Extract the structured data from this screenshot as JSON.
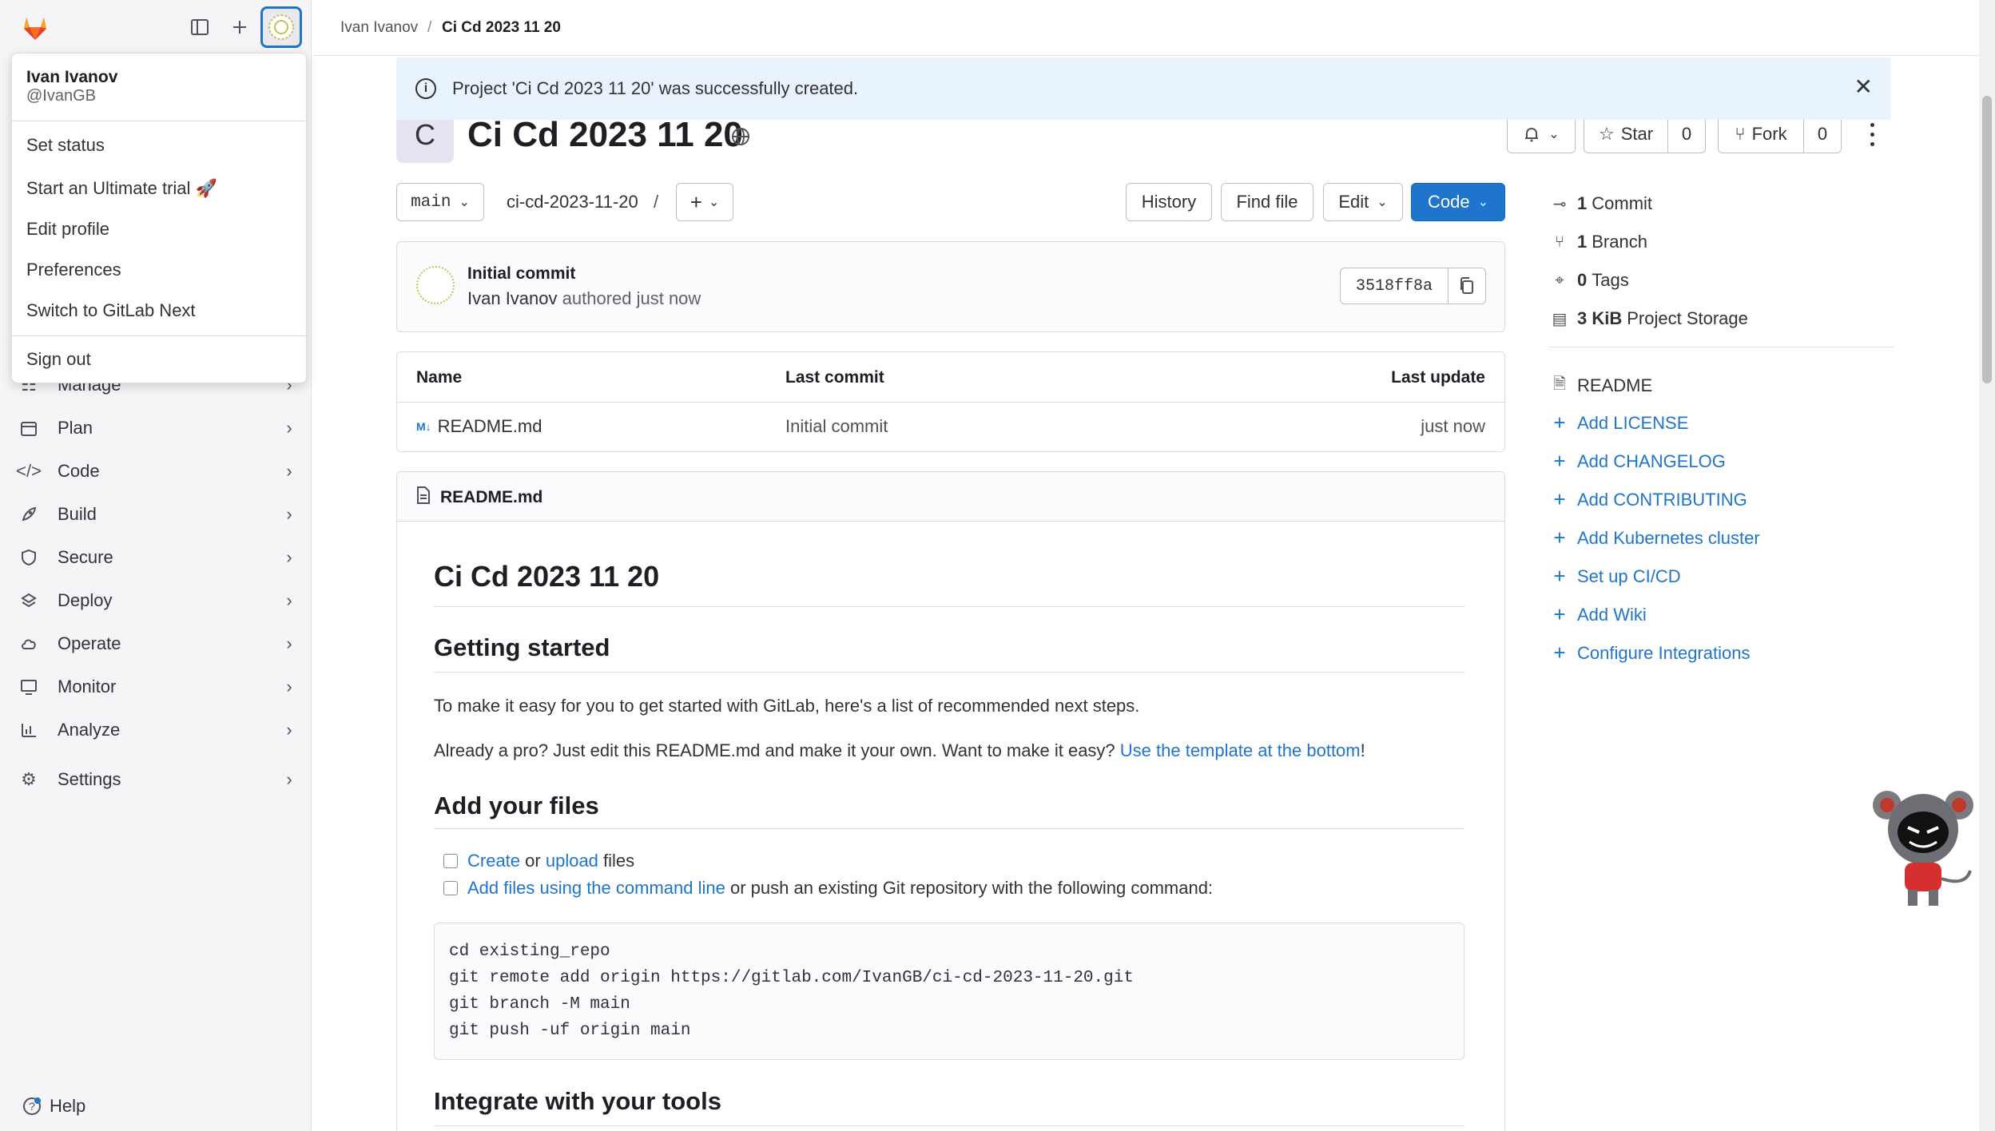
{
  "breadcrumb": {
    "user": "Ivan Ivanov",
    "separator": "/",
    "project": "Ci Cd 2023 11 20"
  },
  "user_menu": {
    "name": "Ivan Ivanov",
    "handle": "@IvanGB",
    "items": [
      "Set status",
      "Start an Ultimate trial 🚀",
      "Edit profile",
      "Preferences",
      "Switch to GitLab Next"
    ],
    "sign_out": "Sign out"
  },
  "sidebar": {
    "items": [
      {
        "label": "Manage",
        "icon": "users-icon"
      },
      {
        "label": "Plan",
        "icon": "calendar-icon"
      },
      {
        "label": "Code",
        "icon": "code-icon"
      },
      {
        "label": "Build",
        "icon": "rocket-icon"
      },
      {
        "label": "Secure",
        "icon": "shield-icon"
      },
      {
        "label": "Deploy",
        "icon": "deploy-icon"
      },
      {
        "label": "Operate",
        "icon": "cloud-icon"
      },
      {
        "label": "Monitor",
        "icon": "monitor-icon"
      },
      {
        "label": "Analyze",
        "icon": "chart-icon"
      },
      {
        "label": "Settings",
        "icon": "gear-icon"
      }
    ],
    "help": "Help"
  },
  "alert": {
    "message": "Project 'Ci Cd 2023 11 20' was successfully created."
  },
  "project": {
    "avatar_letter": "C",
    "title": "Ci Cd 2023 11 20",
    "star_label": "Star",
    "star_count": "0",
    "fork_label": "Fork",
    "fork_count": "0"
  },
  "repo_toolbar": {
    "branch": "main",
    "path": "ci-cd-2023-11-20",
    "path_sep": "/",
    "history": "History",
    "find_file": "Find file",
    "edit": "Edit",
    "code": "Code"
  },
  "last_commit": {
    "title": "Initial commit",
    "author": "Ivan Ivanov",
    "meta": "authored just now",
    "sha": "3518ff8a"
  },
  "file_table": {
    "headers": [
      "Name",
      "Last commit",
      "Last update"
    ],
    "rows": [
      {
        "name": "README.md",
        "commit": "Initial commit",
        "updated": "just now"
      }
    ]
  },
  "readme": {
    "filename": "README.md",
    "h1": "Ci Cd 2023 11 20",
    "getting_started": "Getting started",
    "p1": "To make it easy for you to get started with GitLab, here's a list of recommended next steps.",
    "p2_prefix": "Already a pro? Just edit this README.md and make it your own. Want to make it easy? ",
    "p2_link": "Use the template at the bottom",
    "p2_suffix": "!",
    "add_files": "Add your files",
    "task1_create": "Create",
    "task1_or": " or ",
    "task1_upload": "upload",
    "task1_files": " files",
    "task2_link": "Add files using the command line",
    "task2_rest": " or push an existing Git repository with the following command:",
    "code_lines": [
      "cd existing_repo",
      "git remote add origin https://gitlab.com/IvanGB/ci-cd-2023-11-20.git",
      "git branch -M main",
      "git push -uf origin main"
    ],
    "integrate": "Integrate with your tools"
  },
  "stats": [
    {
      "count": "1",
      "label": "Commit",
      "icon": "commit-icon"
    },
    {
      "count": "1",
      "label": "Branch",
      "icon": "branch-icon"
    },
    {
      "count": "0",
      "label": "Tags",
      "icon": "tag-icon"
    },
    {
      "count": "3 KiB",
      "label": "Project Storage",
      "icon": "storage-icon"
    }
  ],
  "readme_link": "README",
  "quick_links": [
    "Add LICENSE",
    "Add CHANGELOG",
    "Add CONTRIBUTING",
    "Add Kubernetes cluster",
    "Set up CI/CD",
    "Add Wiki",
    "Configure Integrations"
  ],
  "colors": {
    "accent": "#1f75cb",
    "alert_bg": "#e9f3fc",
    "sidebar_bg": "#f5f5f7"
  }
}
